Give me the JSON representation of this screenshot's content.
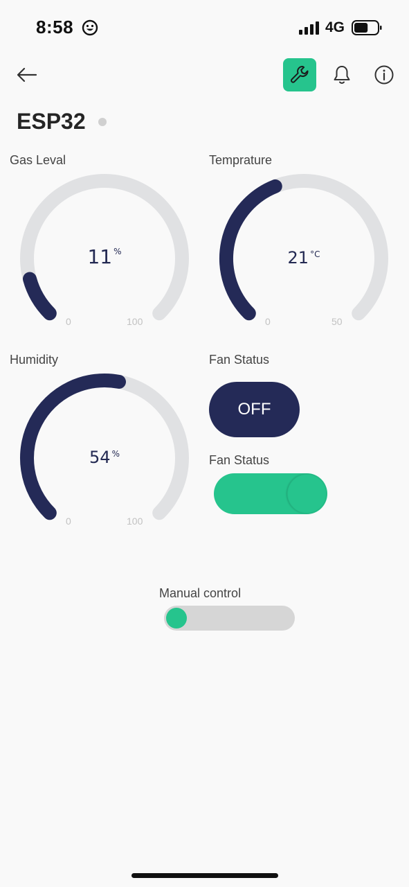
{
  "status_bar": {
    "time": "8:58",
    "network": "4G",
    "battery_percent": 60
  },
  "header": {
    "back_icon": "arrow-left-icon",
    "wrench_icon": "wrench-icon",
    "bell_icon": "bell-icon",
    "info_icon": "info-icon",
    "accent_color": "#26c48d"
  },
  "device": {
    "name": "ESP32",
    "status_dot_color": "#d0d0d0"
  },
  "gauges": [
    {
      "label": "Gas Leval",
      "value": "11",
      "unit": "%",
      "min": "0",
      "max": "100",
      "fraction": 0.11
    },
    {
      "label": "Temprature",
      "value": "21",
      "unit": "°C",
      "min": "0",
      "max": "50",
      "fraction": 0.42
    },
    {
      "label": "Humidity",
      "value": "54",
      "unit": "%",
      "min": "0",
      "max": "100",
      "fraction": 0.54
    }
  ],
  "fan_button": {
    "label": "Fan Status",
    "button_text": "OFF"
  },
  "fan_switch": {
    "label": "Fan Status",
    "state": "on"
  },
  "manual_control": {
    "label": "Manual control",
    "state": "off"
  },
  "colors": {
    "gauge_fill": "#242a57",
    "gauge_track": "#e0e1e3",
    "toggle_on": "#26c48d"
  }
}
